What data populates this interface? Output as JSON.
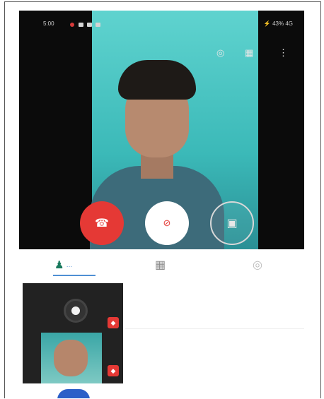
{
  "status_bar": {
    "time": "5:00",
    "right": "⚡ 43% 4G"
  },
  "top_icons": {
    "headset": "◎",
    "grid": "▦",
    "menu": "⋮"
  },
  "call_controls": {
    "end_label": "☎",
    "mute_label": "⊘",
    "video_label": "▣"
  },
  "tabs": {
    "contacts_icon": "♟",
    "contacts_label": "…",
    "grid_icon": "▦",
    "settings_icon": "◎"
  },
  "list": {
    "row1_text": "",
    "row2_text": "",
    "row2_count": "",
    "badge1": "◆",
    "badge2": "◆"
  }
}
